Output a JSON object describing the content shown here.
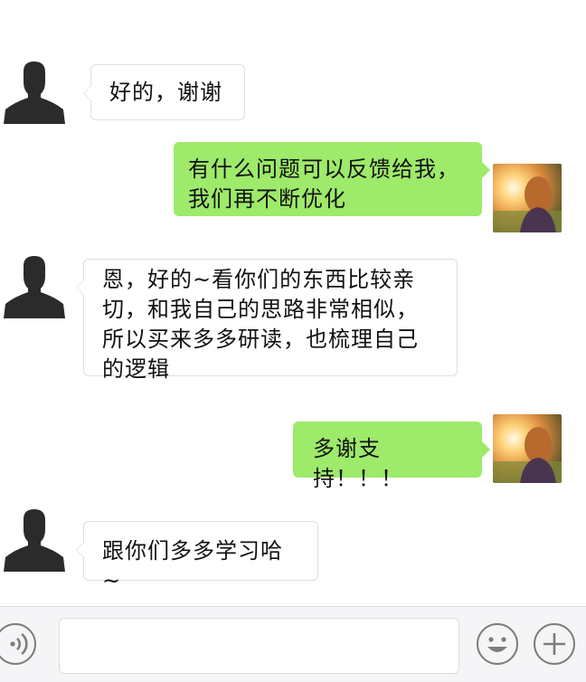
{
  "chat": {
    "messages": [
      {
        "sender": "contact",
        "text": "好的，谢谢"
      },
      {
        "sender": "me",
        "lines": [
          "有什么问题可以反馈给我，",
          "我们再不断优化"
        ]
      },
      {
        "sender": "contact",
        "lines": [
          "恩，好的~看你们的东西比较亲",
          "切，和我自己的思路非常相似，",
          "所以买来多多研读，也梳理自己",
          "的逻辑"
        ]
      },
      {
        "sender": "me",
        "text": "多谢支持！！！"
      },
      {
        "sender": "contact",
        "text": "跟你们多多学习哈~"
      }
    ]
  },
  "input_bar": {
    "voice_icon": "voice-icon",
    "emoji_icon": "emoji-icon",
    "plus_icon": "plus-icon",
    "input_value": "",
    "input_placeholder": ""
  },
  "colors": {
    "outgoing_bubble": "#9eea6a",
    "incoming_bubble": "#ffffff",
    "avatar_silhouette": "#2b2b2b",
    "bottom_bar": "#f5f5f7"
  }
}
